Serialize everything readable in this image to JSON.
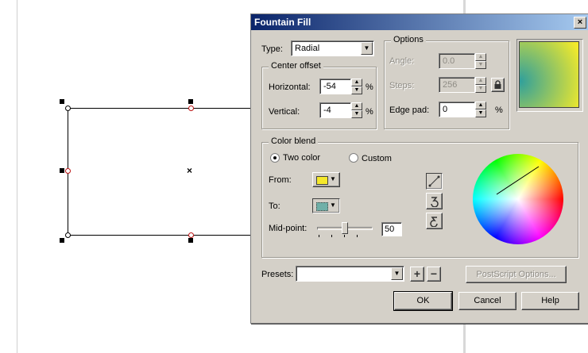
{
  "dialog": {
    "title": "Fountain Fill",
    "close_glyph": "×"
  },
  "type": {
    "label": "Type:",
    "value": "Radial"
  },
  "center_offset": {
    "group_label": "Center offset",
    "horizontal_label": "Horizontal:",
    "horizontal_value": "-54",
    "vertical_label": "Vertical:",
    "vertical_value": "-4",
    "unit": "%"
  },
  "options": {
    "group_label": "Options",
    "angle_label": "Angle:",
    "angle_value": "0.0",
    "steps_label": "Steps:",
    "steps_value": "256",
    "edge_pad_label": "Edge pad:",
    "edge_pad_value": "0",
    "unit": "%"
  },
  "preview": {
    "color_from": "#2f9f9c",
    "color_to": "#f3ea2a"
  },
  "color_blend": {
    "group_label": "Color blend",
    "two_color_label": "Two color",
    "custom_label": "Custom",
    "from_label": "From:",
    "from_color": "#f5e82a",
    "to_label": "To:",
    "to_color": "#6fb0a8",
    "midpoint_label": "Mid-point:",
    "midpoint_value": "50",
    "midpoint_fraction": 0.5
  },
  "presets": {
    "label": "Presets:",
    "value": ""
  },
  "buttons": {
    "postscript": "PostScript Options...",
    "ok": "OK",
    "cancel": "Cancel",
    "help": "Help"
  }
}
